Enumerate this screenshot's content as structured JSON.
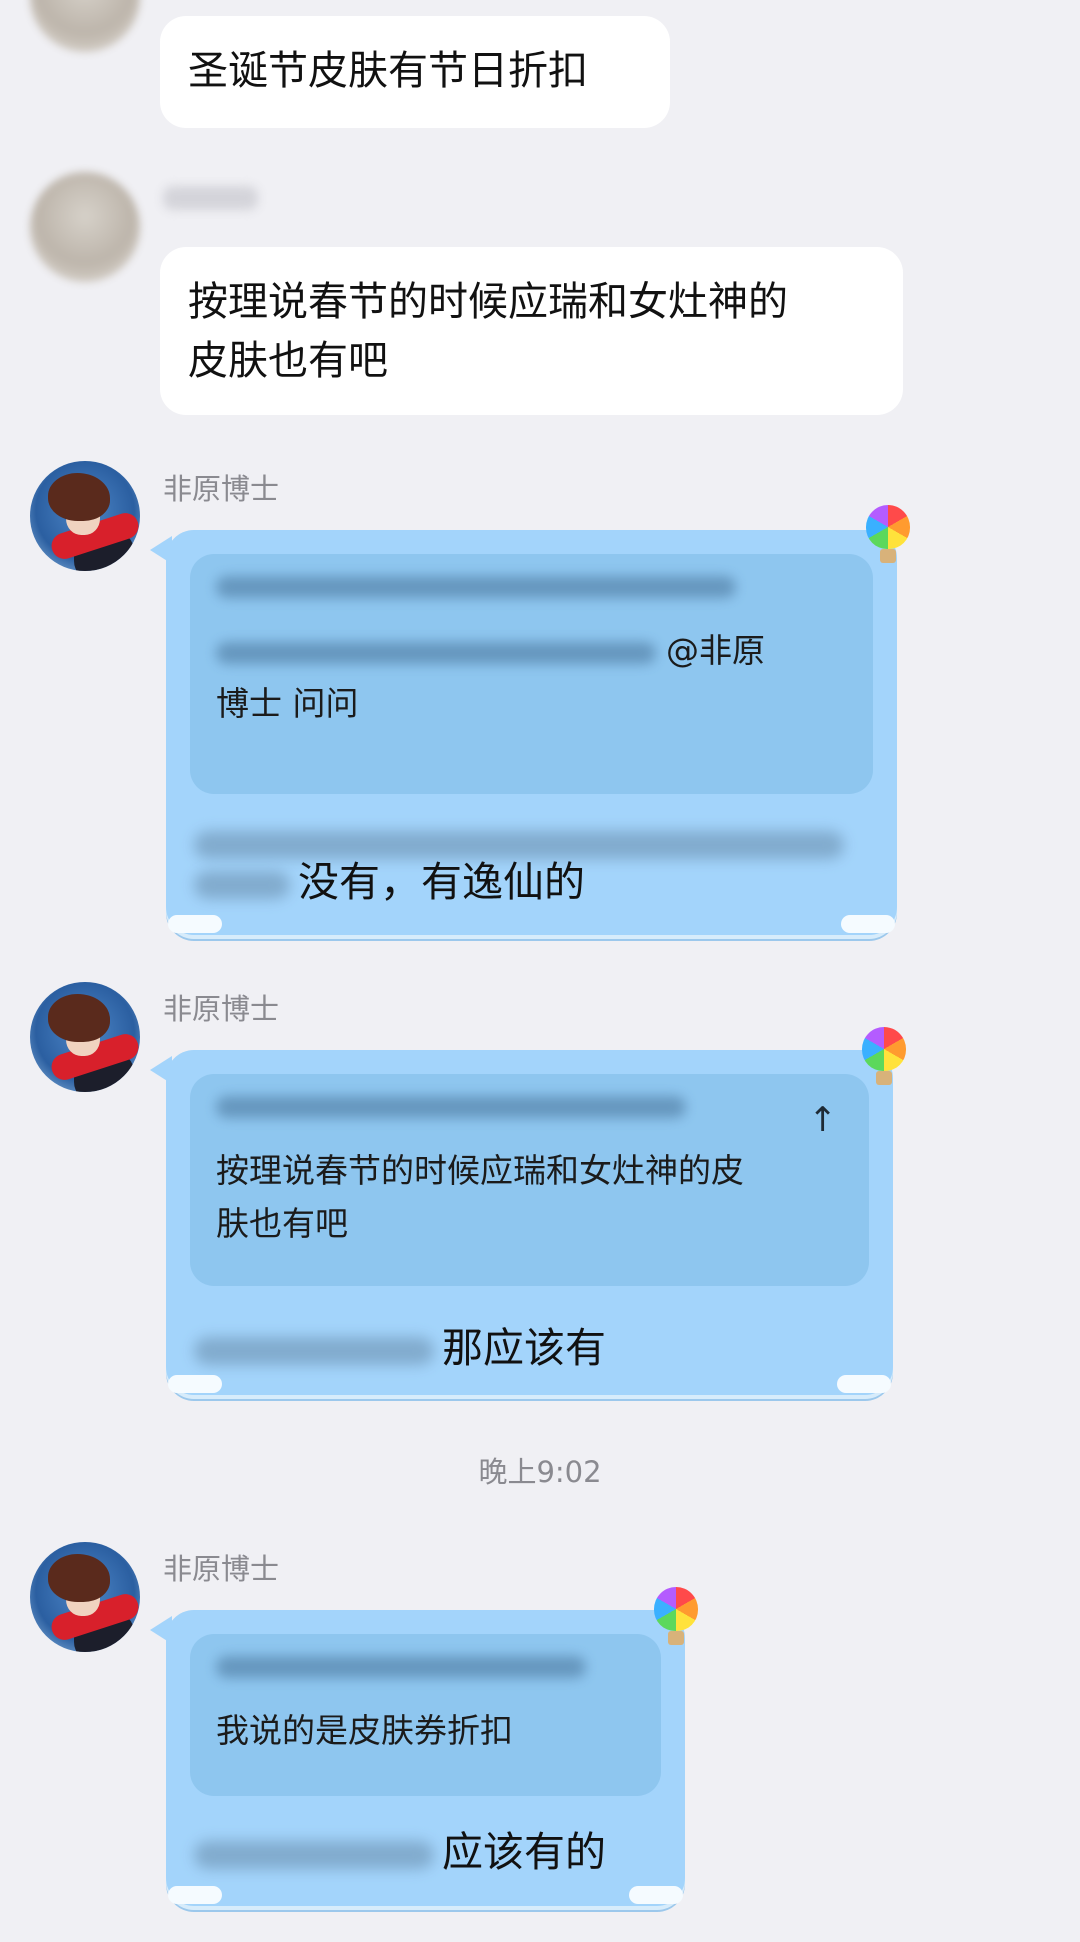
{
  "messages": [
    {
      "type": "text",
      "text": "圣诞节皮肤有节日折扣"
    },
    {
      "type": "text",
      "text_line1": "按理说春节的时候应瑞和女灶神的",
      "text_line2": "皮肤也有吧"
    },
    {
      "type": "reply",
      "sender": "非原博士",
      "quote_line1": "@非原",
      "quote_line2": "博士 问问",
      "reply_text": "没有，有逸仙的"
    },
    {
      "type": "reply",
      "sender": "非原博士",
      "quote_line1": "按理说春节的时候应瑞和女灶神的皮",
      "quote_line2": "肤也有吧",
      "reply_text": "那应该有"
    },
    {
      "type": "reply",
      "sender": "非原博士",
      "quote_line1": "我说的是皮肤券折扣",
      "reply_text": "应该有的"
    }
  ],
  "timestamp": "晚上9:02",
  "icons": {
    "pin": "↑"
  },
  "colors": {
    "background": "#f0f0f4",
    "blue_bubble": "#a3d4fb",
    "quote_box": "#8ec6ef"
  }
}
